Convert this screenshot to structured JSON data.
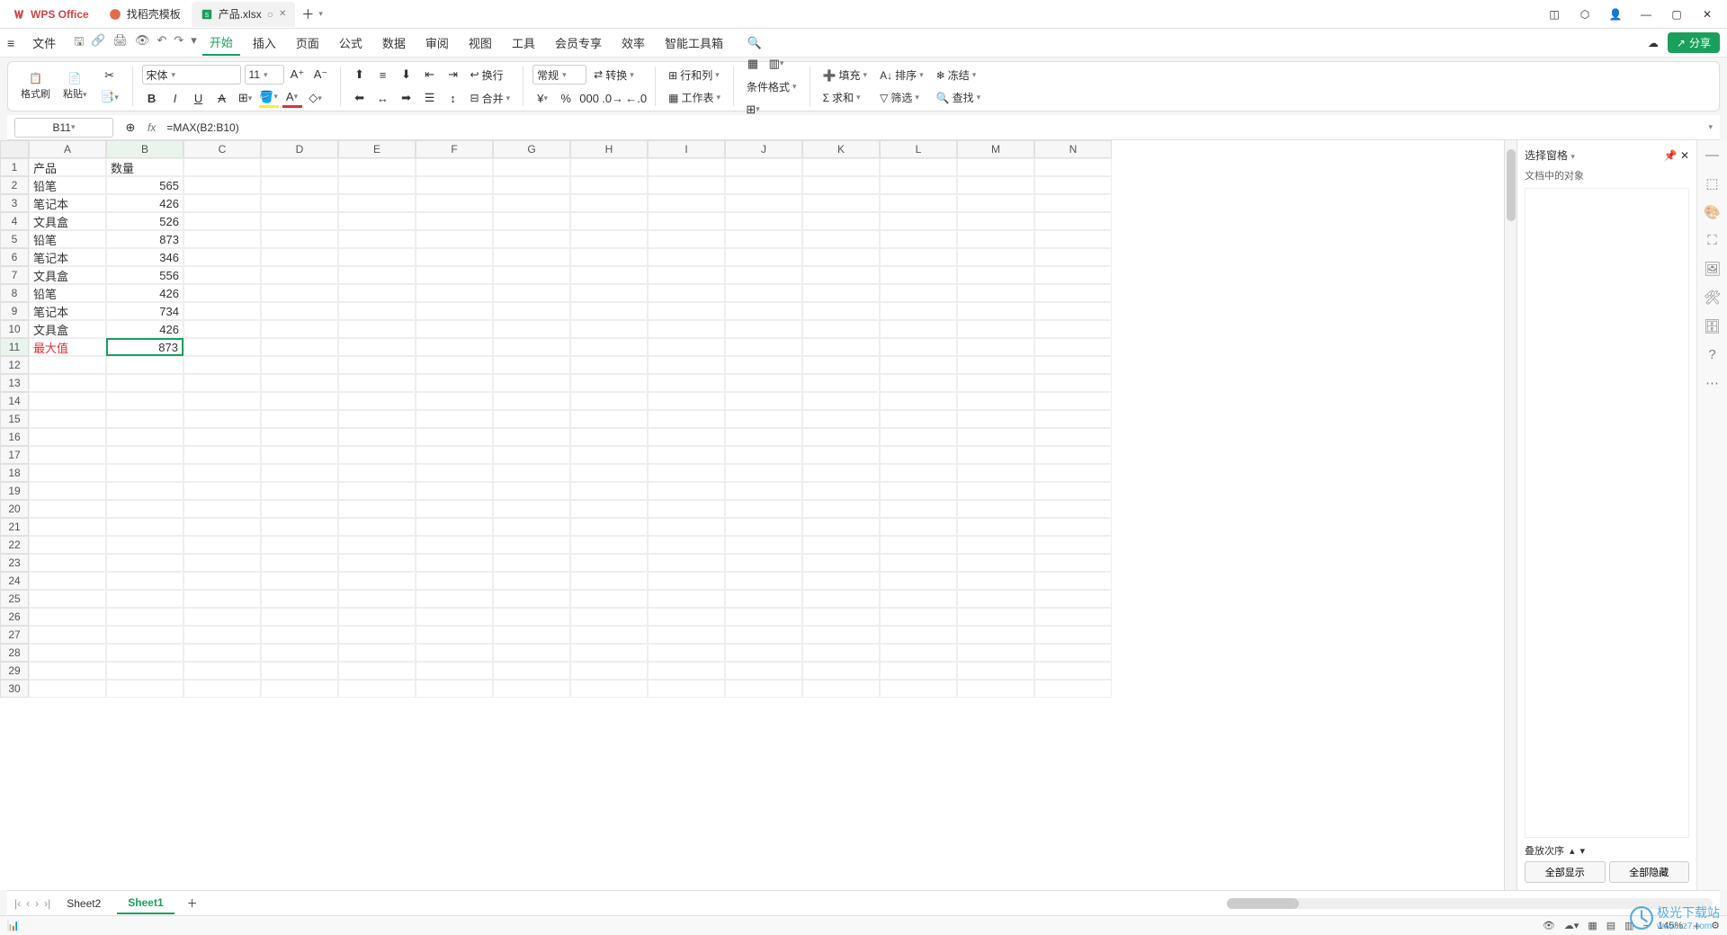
{
  "titlebar": {
    "app": "WPS Office",
    "tab_template": "找稻壳模板",
    "file_tab": "产品.xlsx"
  },
  "menubar": {
    "file": "文件",
    "items": [
      "开始",
      "插入",
      "页面",
      "公式",
      "数据",
      "审阅",
      "视图",
      "工具",
      "会员专享",
      "效率",
      "智能工具箱"
    ],
    "share": "分享"
  },
  "ribbon": {
    "format_brush": "格式刷",
    "paste": "粘贴",
    "font_name": "宋体",
    "font_size": "11",
    "wrap": "换行",
    "merge": "合并",
    "numfmt": "常规",
    "convert": "转换",
    "rowcol": "行和列",
    "worksheet": "工作表",
    "cond_fmt": "条件格式",
    "fill": "填充",
    "sort": "排序",
    "freeze": "冻结",
    "sum": "求和",
    "filter": "筛选",
    "find": "查找"
  },
  "namebox": {
    "cell": "B11",
    "formula": "=MAX(B2:B10)"
  },
  "columns": [
    "A",
    "B",
    "C",
    "D",
    "E",
    "F",
    "G",
    "H",
    "I",
    "J",
    "K",
    "L",
    "M",
    "N"
  ],
  "rows_count": 30,
  "data": {
    "A1": "产品",
    "B1": "数量",
    "A2": "铅笔",
    "B2": "565",
    "A3": "笔记本",
    "B3": "426",
    "A4": "文具盒",
    "B4": "526",
    "A5": "铅笔",
    "B5": "873",
    "A6": "笔记本",
    "B6": "346",
    "A7": "文具盒",
    "B7": "556",
    "A8": "铅笔",
    "B8": "426",
    "A9": "笔记本",
    "B9": "734",
    "A10": "文具盒",
    "B10": "426",
    "A11": "最大值",
    "B11": "873"
  },
  "selected_cell": "B11",
  "side": {
    "title": "选择窗格",
    "subtitle": "文档中的对象",
    "stack": "叠放次序",
    "show_all": "全部显示",
    "hide_all": "全部隐藏"
  },
  "sheets": {
    "list": [
      "Sheet2",
      "Sheet1"
    ],
    "active": "Sheet1"
  },
  "status": {
    "zoom": "145%"
  },
  "watermark": {
    "brand": "极光下载站",
    "url": "www.xz7.com"
  }
}
